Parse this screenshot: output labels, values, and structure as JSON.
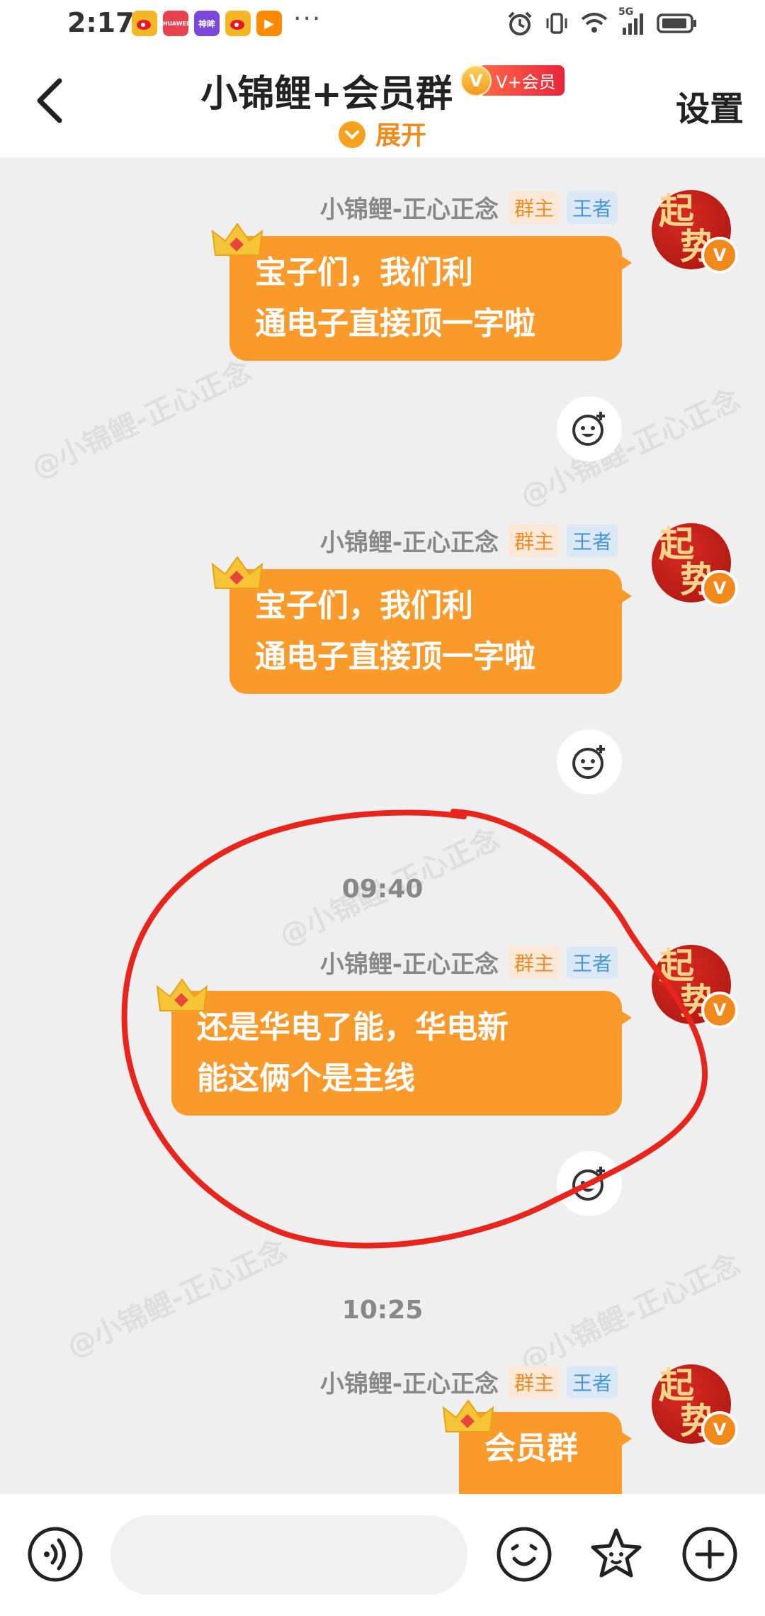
{
  "status_bar": {
    "time": "2:17",
    "more": "···",
    "network": "5G",
    "apps": [
      {
        "name": "weibo-app-icon",
        "label": "",
        "color": "#f5b623"
      },
      {
        "name": "huawei-app-icon",
        "label": "HUAWEI",
        "color": "#e8414e"
      },
      {
        "name": "shenhui-app-icon",
        "label": "神眸",
        "color": "#7b47d8"
      },
      {
        "name": "weibo-app-icon-2",
        "label": "",
        "color": "#f5b623"
      },
      {
        "name": "video-app-icon",
        "label": "▶",
        "color": "#ff8a00"
      }
    ]
  },
  "header": {
    "title": "小锦鲤+会员群",
    "badge_coin": "V",
    "badge_text": "V+会员",
    "expand_label": "展开",
    "settings_label": "设置"
  },
  "watermark": "@小锦鲤-正心正念",
  "messages": [
    {
      "sender": "小锦鲤-正心正念",
      "role_tag": "群主",
      "rank_tag": "王者",
      "avatar_chars": [
        "起",
        "势"
      ],
      "text_lines": [
        "宝子们，我们利",
        "通电子直接顶一字啦"
      ]
    },
    {
      "sender": "小锦鲤-正心正念",
      "role_tag": "群主",
      "rank_tag": "王者",
      "avatar_chars": [
        "起",
        "势"
      ],
      "text_lines": [
        "宝子们，我们利",
        "通电子直接顶一字啦"
      ]
    },
    {
      "timestamp": "09:40",
      "sender": "小锦鲤-正心正念",
      "role_tag": "群主",
      "rank_tag": "王者",
      "avatar_chars": [
        "起",
        "势"
      ],
      "text_lines": [
        "还是华电了能，华电新",
        "能这俩个是主线"
      ]
    },
    {
      "timestamp": "10:25",
      "sender": "小锦鲤-正心正念",
      "role_tag": "群主",
      "rank_tag": "王者",
      "avatar_chars": [
        "起",
        "势"
      ],
      "text_lines": [
        "会员群"
      ]
    }
  ],
  "avatar_badge": "V",
  "colors": {
    "bubble": "#fa9a2b",
    "accent": "#f08c1c",
    "annotation_red": "#e8251c",
    "background": "#efefef"
  },
  "bottom_bar": {
    "input_value": "",
    "icons": [
      "voice-icon",
      "emoji-icon",
      "sticker-icon",
      "add-icon"
    ]
  }
}
